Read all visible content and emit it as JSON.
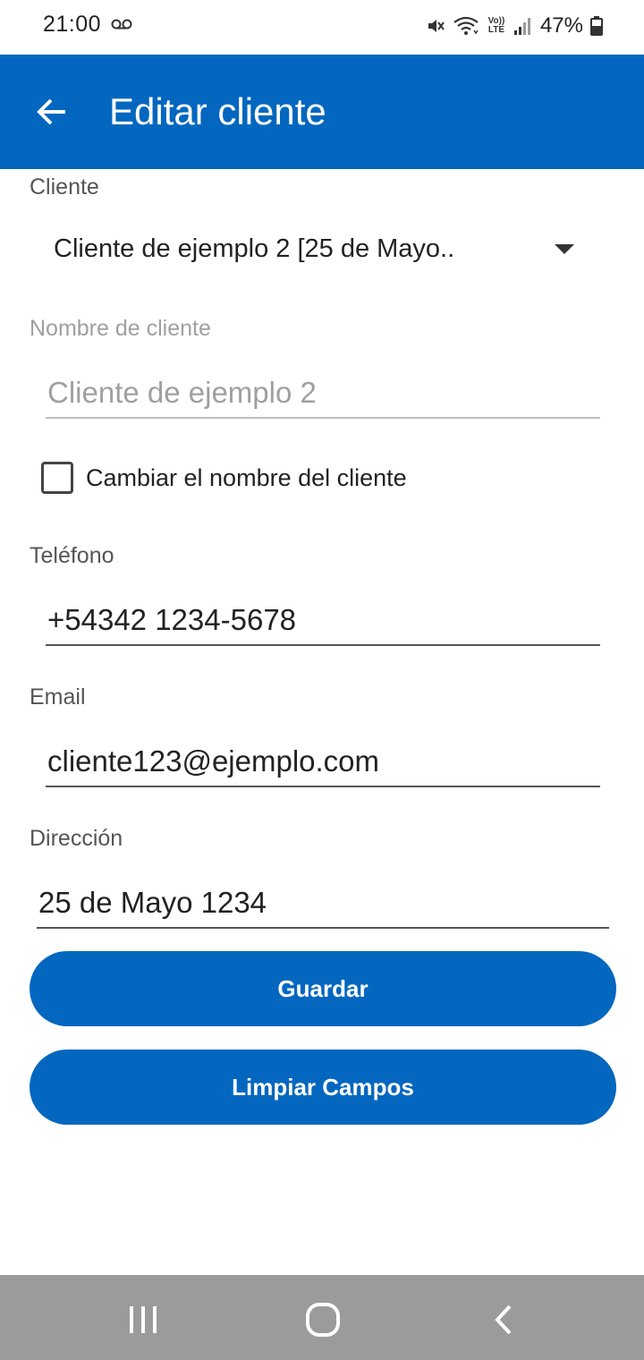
{
  "status_bar": {
    "time": "21:00",
    "battery_percent": "47%",
    "volte_top": "Vo))",
    "volte_bottom": "LTE",
    "icons": [
      "voicemail-icon",
      "mute-icon",
      "wifi-icon",
      "volte-icon",
      "signal-icon",
      "battery-icon"
    ]
  },
  "app_bar": {
    "title": "Editar cliente",
    "back_icon": "arrow-left-icon",
    "color": "#0367bf"
  },
  "form": {
    "cliente_label": "Cliente",
    "cliente_selected": "Cliente de ejemplo 2 [25 de Mayo..",
    "nombre_label": "Nombre de cliente",
    "nombre_value": "Cliente de ejemplo 2",
    "cambiar_nombre_label": "Cambiar el nombre del cliente",
    "cambiar_nombre_checked": false,
    "telefono_label": "Teléfono",
    "telefono_value": "+54342 1234-5678",
    "email_label": "Email",
    "email_value": "cliente123@ejemplo.com",
    "direccion_label": "Dirección",
    "direccion_value": "25 de Mayo 1234"
  },
  "buttons": {
    "guardar": "Guardar",
    "limpiar": "Limpiar Campos"
  },
  "nav_bar": {
    "icons": [
      "recents-icon",
      "home-icon",
      "back-icon"
    ]
  }
}
